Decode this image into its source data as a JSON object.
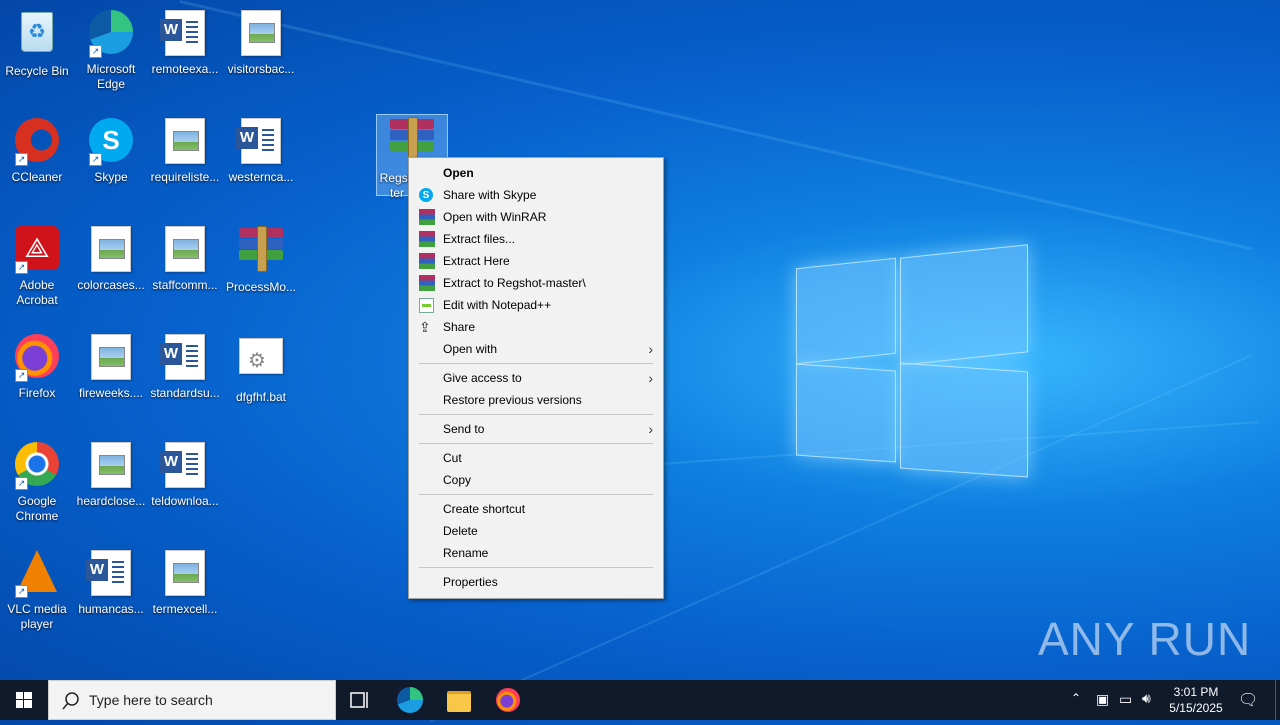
{
  "desktop_icons": [
    {
      "label": "Recycle Bin",
      "type": "recycle"
    },
    {
      "label": "Microsoft Edge",
      "type": "edge"
    },
    {
      "label": "remoteexa...",
      "type": "word"
    },
    {
      "label": "visitorsbac...",
      "type": "image"
    },
    {
      "label": "CCleaner",
      "type": "ccleaner"
    },
    {
      "label": "Skype",
      "type": "skype"
    },
    {
      "label": "requireliste...",
      "type": "image"
    },
    {
      "label": "westernca...",
      "type": "word"
    },
    {
      "label": "Regsh ter",
      "type": "winrar"
    },
    {
      "label": "Adobe Acrobat",
      "type": "acrobat"
    },
    {
      "label": "colorcases...",
      "type": "image"
    },
    {
      "label": "staffcomm...",
      "type": "image"
    },
    {
      "label": "ProcessMo...",
      "type": "winrar"
    },
    {
      "label": "Firefox",
      "type": "firefox"
    },
    {
      "label": "fireweeks....",
      "type": "image"
    },
    {
      "label": "standardsu...",
      "type": "word"
    },
    {
      "label": "dfgfhf.bat",
      "type": "bat"
    },
    {
      "label": "Google Chrome",
      "type": "chrome"
    },
    {
      "label": "heardclose...",
      "type": "image"
    },
    {
      "label": "teldownloa...",
      "type": "word"
    },
    {
      "label": "VLC media player",
      "type": "vlc"
    },
    {
      "label": "humancas...",
      "type": "word"
    },
    {
      "label": "termexcell...",
      "type": "image"
    }
  ],
  "context_menu": {
    "items": [
      {
        "label": "Open",
        "icon": "none",
        "bold": true
      },
      {
        "label": "Share with Skype",
        "icon": "skype-icon"
      },
      {
        "label": "Open with WinRAR",
        "icon": "winrar-icon"
      },
      {
        "label": "Extract files...",
        "icon": "winrar-icon"
      },
      {
        "label": "Extract Here",
        "icon": "winrar-icon"
      },
      {
        "label": "Extract to Regshot-master\\",
        "icon": "winrar-icon"
      },
      {
        "label": "Edit with Notepad++",
        "icon": "notepadpp-icon"
      },
      {
        "label": "Share",
        "icon": "share-icon"
      },
      {
        "label": "Open with",
        "icon": "none",
        "submenu": true
      },
      {
        "label": "Give access to",
        "icon": "none",
        "submenu": true
      },
      {
        "label": "Restore previous versions",
        "icon": "none"
      },
      {
        "label": "Send to",
        "icon": "none",
        "submenu": true
      },
      {
        "label": "Cut",
        "icon": "none"
      },
      {
        "label": "Copy",
        "icon": "none"
      },
      {
        "label": "Create shortcut",
        "icon": "none"
      },
      {
        "label": "Delete",
        "icon": "none"
      },
      {
        "label": "Rename",
        "icon": "none"
      },
      {
        "label": "Properties",
        "icon": "none"
      }
    ]
  },
  "taskbar": {
    "search_placeholder": "Type here to search",
    "time": "3:01 PM",
    "date": "5/15/2025"
  },
  "watermark": "ANY RUN",
  "colors": {
    "menu_bg": "#f2f2f2",
    "taskbar": "#101a2a",
    "accent": "#0078d7"
  }
}
